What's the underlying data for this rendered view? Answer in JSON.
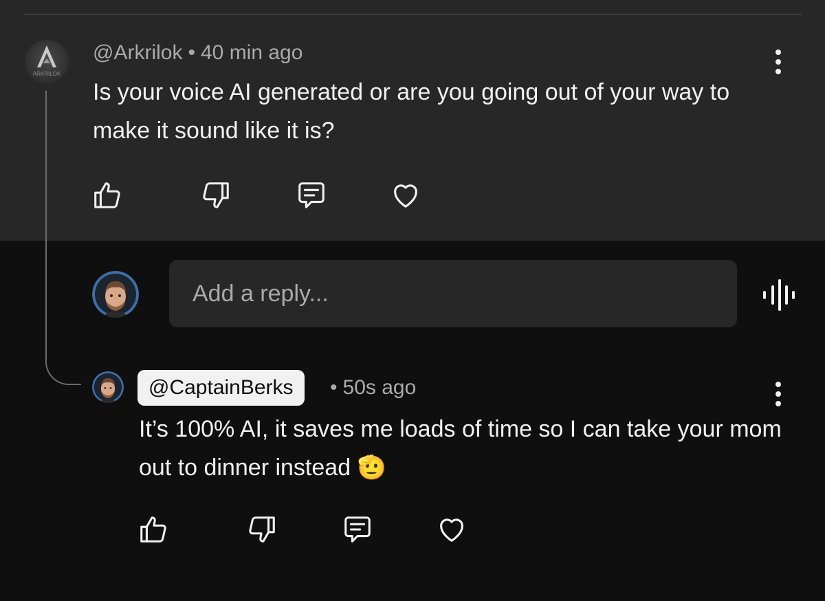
{
  "comment": {
    "author": "@Arkrilok",
    "avatar_label": "ARKRILOK",
    "separator": "•",
    "time": "40 min ago",
    "text": "Is your voice AI generated or are you going out of your way to make it sound like it is?"
  },
  "reply_input": {
    "placeholder": "Add a reply..."
  },
  "reply": {
    "author": "@CaptainBerks",
    "separator": "•",
    "time": "50s ago",
    "text": "It’s 100% AI, it saves me loads of time so I can take your mom out to dinner instead 🫡"
  },
  "icons": {
    "more": "more-vertical-icon",
    "like": "thumbs-up-icon",
    "dislike": "thumbs-down-icon",
    "reply": "comment-icon",
    "heart": "heart-icon",
    "voice": "voice-search-icon"
  },
  "colors": {
    "top_background": "#272727",
    "page_background": "#0f0f0f",
    "text_primary": "#f1f1f1",
    "text_secondary": "#aaaaaa",
    "author_highlight": "#f1f1f1"
  }
}
